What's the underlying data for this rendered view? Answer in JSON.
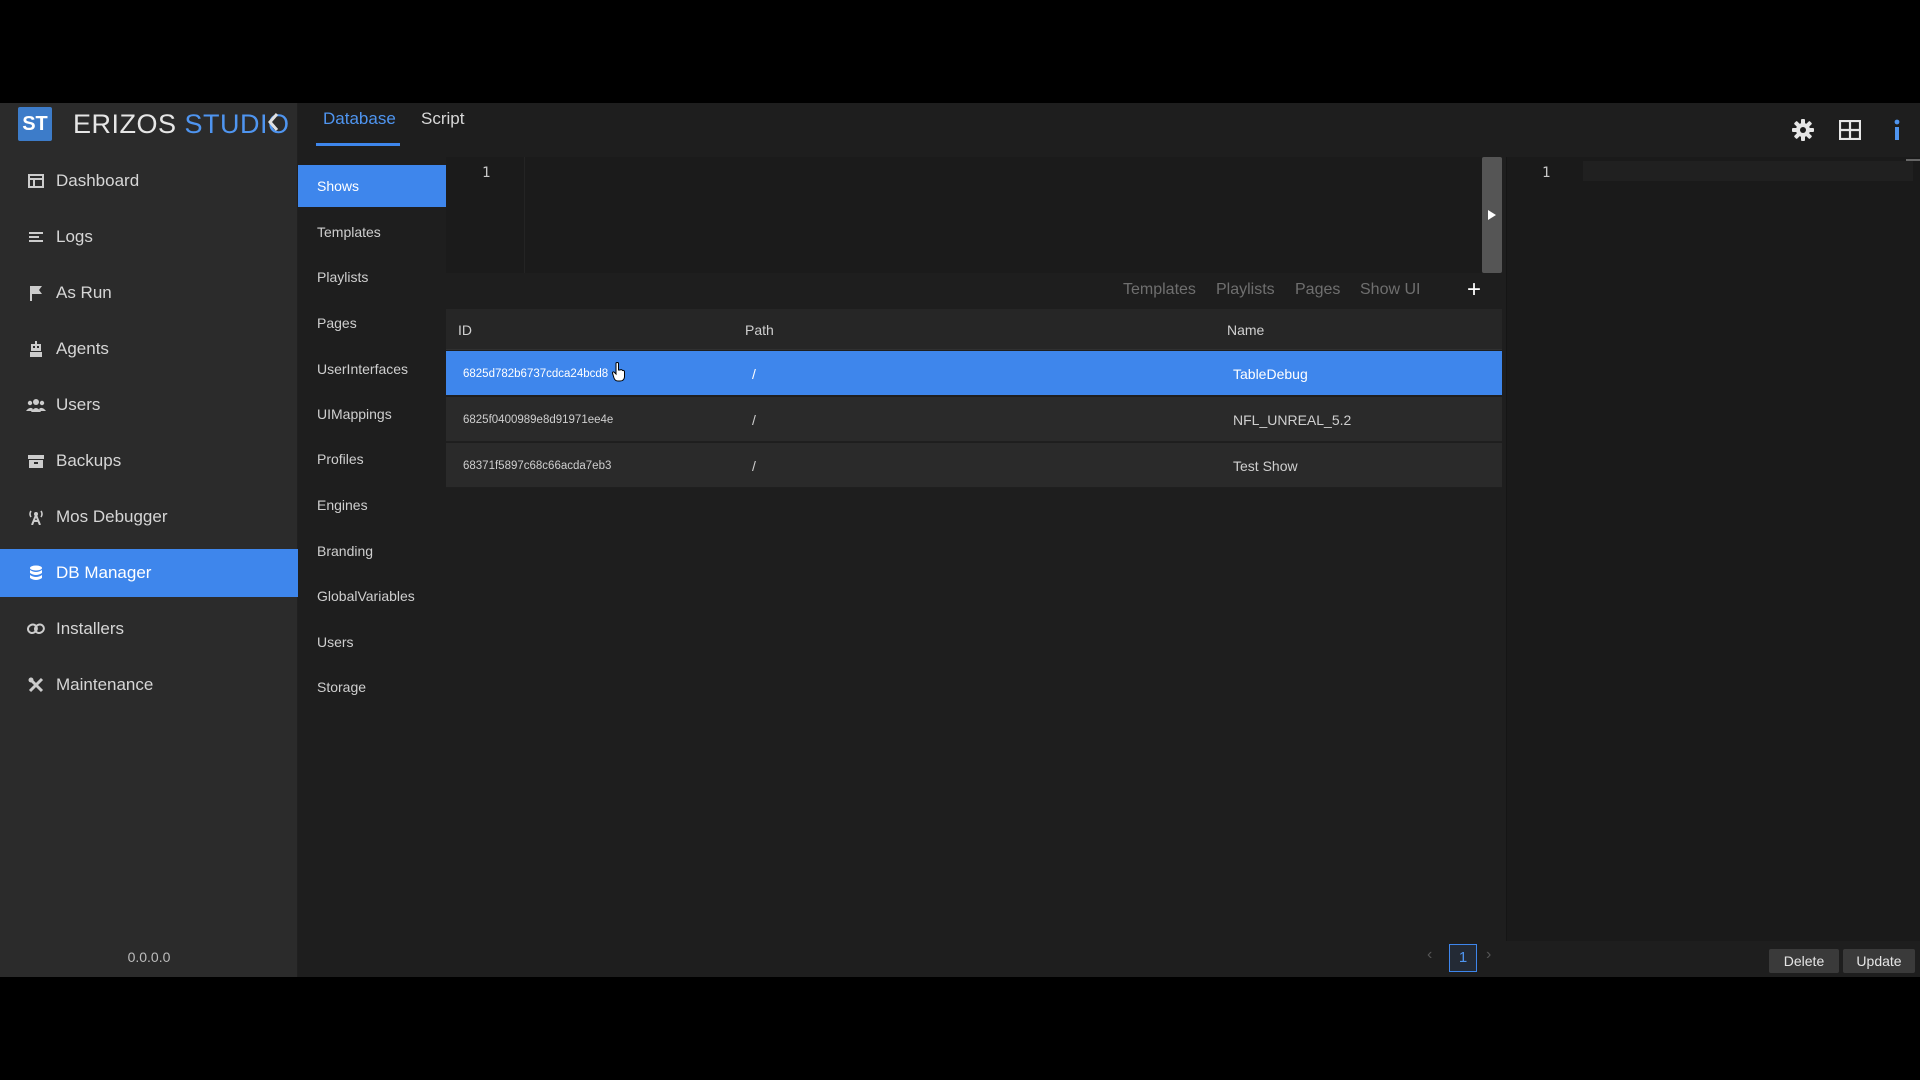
{
  "app": {
    "logo_badge": "ST",
    "logo_text_a": "ERIZOS",
    "logo_text_b": "STUDIO",
    "version": "0.0.0.0"
  },
  "sidebar": {
    "items": [
      {
        "label": "Dashboard",
        "icon": "dashboard-icon"
      },
      {
        "label": "Logs",
        "icon": "list-icon"
      },
      {
        "label": "As Run",
        "icon": "flag-icon"
      },
      {
        "label": "Agents",
        "icon": "robot-icon"
      },
      {
        "label": "Users",
        "icon": "users-icon"
      },
      {
        "label": "Backups",
        "icon": "archive-icon"
      },
      {
        "label": "Mos Debugger",
        "icon": "broadcast-icon"
      },
      {
        "label": "DB Manager",
        "icon": "database-icon",
        "active": true
      },
      {
        "label": "Installers",
        "icon": "link-icon"
      },
      {
        "label": "Maintenance",
        "icon": "tools-icon"
      }
    ]
  },
  "tabs": {
    "database": "Database",
    "script": "Script"
  },
  "toolbar_icons": [
    "settings-icon",
    "layout-icon",
    "info-icon"
  ],
  "collections": [
    "Shows",
    "Templates",
    "Playlists",
    "Pages",
    "UserInterfaces",
    "UIMappings",
    "Profiles",
    "Engines",
    "Branding",
    "GlobalVariables",
    "Users",
    "Storage"
  ],
  "query_editor": {
    "line_number": "1"
  },
  "filters": [
    "Templates",
    "Playlists",
    "Pages",
    "Show UI"
  ],
  "add_label": "+",
  "table": {
    "headers": {
      "id": "ID",
      "path": "Path",
      "name": "Name"
    },
    "rows": [
      {
        "id": "6825d782b6737cdca24bcd8",
        "path": "/",
        "name": "TableDebug",
        "selected": true
      },
      {
        "id": "6825f0400989e8d91971ee4e",
        "path": "/",
        "name": "NFL_UNREAL_5.2"
      },
      {
        "id": "68371f5897c68c66acda7eb3",
        "path": "/",
        "name": "Test Show"
      }
    ]
  },
  "pagination": {
    "prev": "‹",
    "current": "1",
    "next": "›"
  },
  "result_editor": {
    "line_number": "1"
  },
  "buttons": {
    "delete": "Delete",
    "update": "Update"
  },
  "colors": {
    "accent": "#3e86ec",
    "sidebar_bg": "#2b2b2b",
    "main_bg": "#1e1e1e"
  }
}
